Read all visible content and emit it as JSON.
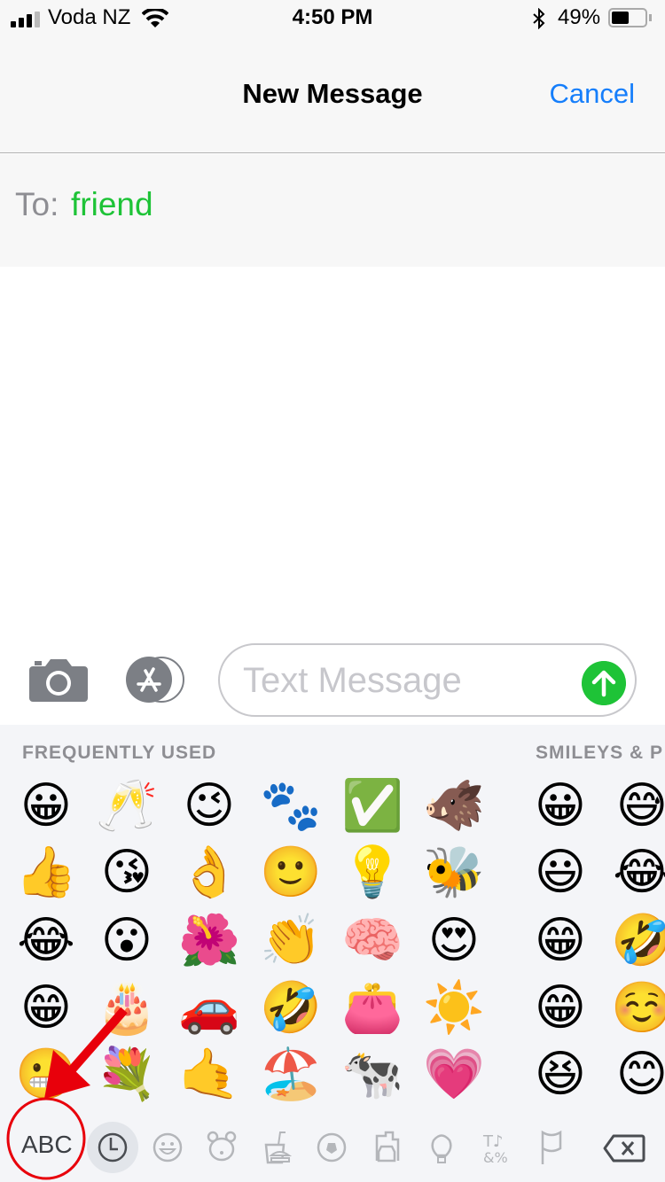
{
  "status_bar": {
    "carrier": "Voda NZ",
    "time": "4:50 PM",
    "battery": "49%",
    "battery_level": 0.49,
    "icons": [
      "signal-icon",
      "wifi-icon",
      "bluetooth-icon",
      "battery-icon"
    ]
  },
  "nav": {
    "title": "New Message",
    "cancel": "Cancel"
  },
  "recipient": {
    "label": "To:",
    "value": "friend"
  },
  "compose": {
    "placeholder": "Text Message",
    "icons": [
      "camera-icon",
      "app-store-icon",
      "send-icon"
    ]
  },
  "colors": {
    "accent": "#157efb",
    "green": "#1ec337",
    "annotation": "#e8000b"
  },
  "keyboard": {
    "sections": [
      "FREQUENTLY USED",
      "SMILEYS & P"
    ],
    "frequently_used": [
      [
        "😀",
        "🥂",
        "😉",
        "🐾",
        "✅",
        "🐗"
      ],
      [
        "👍",
        "😘",
        "👌",
        "🙂",
        "💡",
        "🐝"
      ],
      [
        "😂",
        "😮",
        "🌺",
        "👏",
        "🧠",
        "😍"
      ],
      [
        "😁",
        "🎂",
        "🚗",
        "🤣",
        "👛",
        "☀️"
      ],
      [
        "😬",
        "💐",
        "🤙",
        "🏖️",
        "🐄",
        "💗"
      ]
    ],
    "smileys": [
      [
        "😀",
        "😅"
      ],
      [
        "😃",
        "😂"
      ],
      [
        "😁",
        "🤣"
      ],
      [
        "😁",
        "☺️"
      ],
      [
        "😆",
        "😊"
      ]
    ],
    "abc": "ABC",
    "categories": [
      "clock-icon",
      "smiley-icon",
      "bear-icon",
      "food-icon",
      "soccer-ball-icon",
      "car-building-icon",
      "lightbulb-icon",
      "symbols-icon",
      "flag-icon"
    ],
    "selected_category": "clock-icon"
  }
}
